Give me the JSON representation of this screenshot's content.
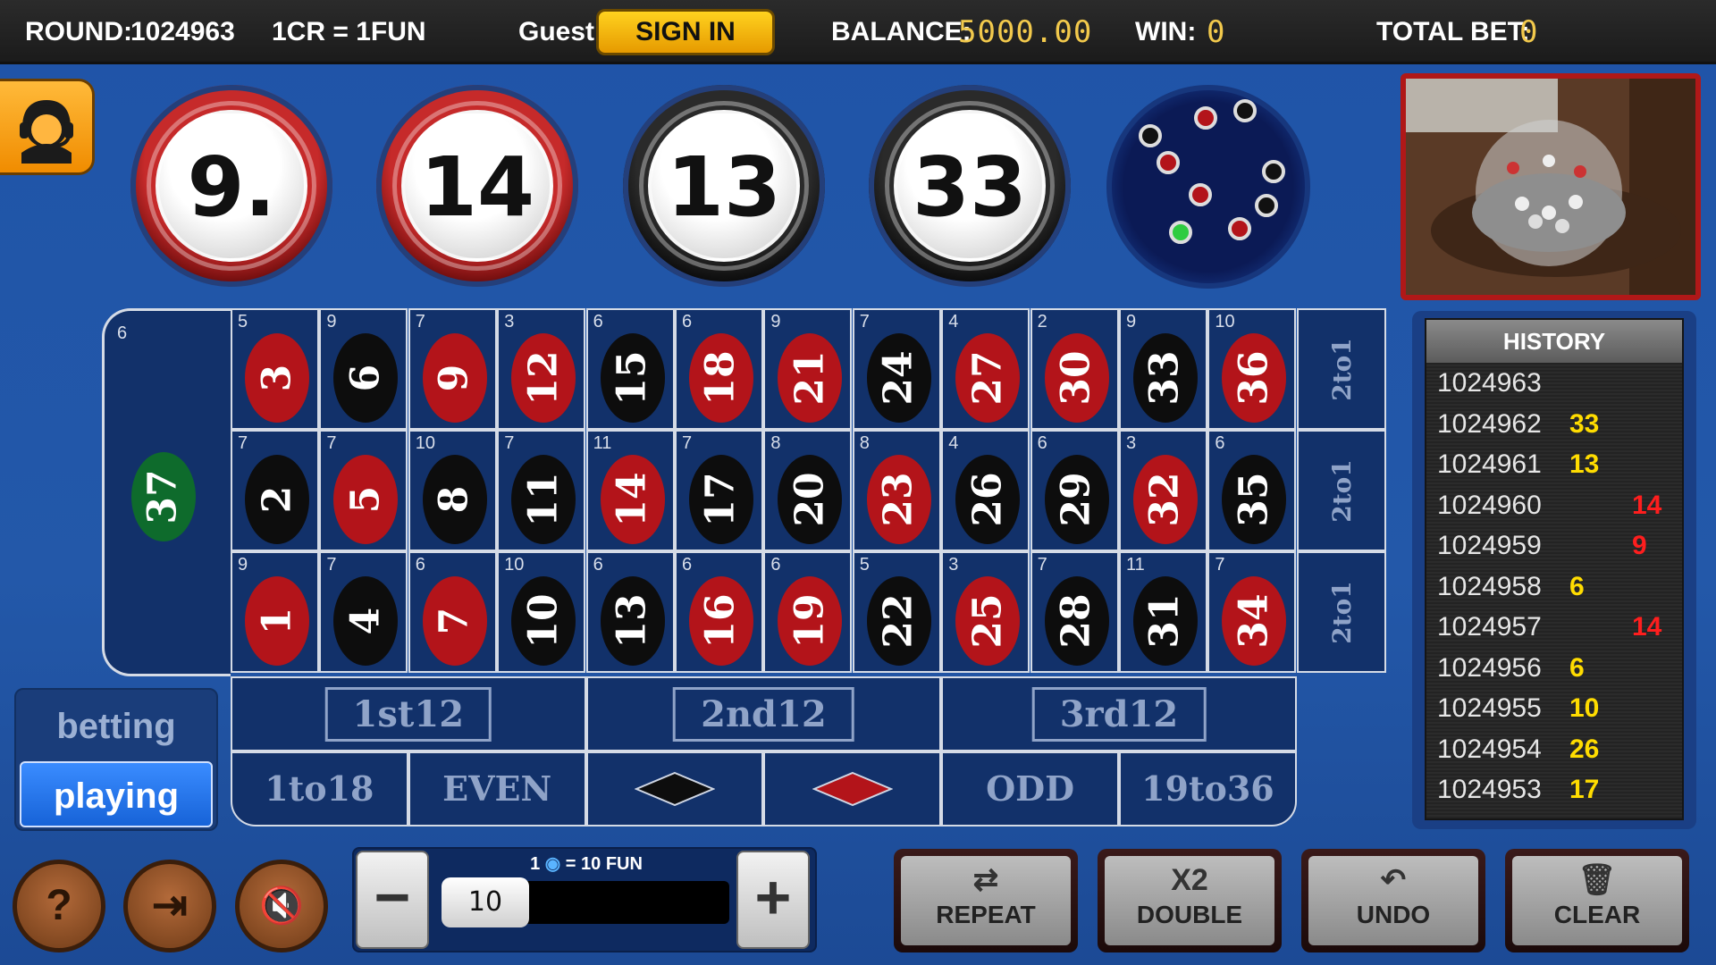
{
  "topbar": {
    "round_label": "ROUND:",
    "round_value": "1024963",
    "rate": "1CR = 1FUN",
    "user": "Guest",
    "signin_label": "SIGN IN",
    "balance_label": "BALANCE:",
    "balance_value": "5000.00",
    "win_label": "WIN:",
    "win_value": "0",
    "totalbet_label": "TOTAL BET:",
    "totalbet_value": "0"
  },
  "last_balls": [
    {
      "value": "9.",
      "color": "red"
    },
    {
      "value": "14",
      "color": "red"
    },
    {
      "value": "13",
      "color": "black"
    },
    {
      "value": "33",
      "color": "black"
    }
  ],
  "table": {
    "zero": {
      "number": "37",
      "chips": "6",
      "color": "green"
    },
    "rows": [
      [
        {
          "n": "3",
          "c": "red",
          "k": "5"
        },
        {
          "n": "6",
          "c": "black",
          "k": "9"
        },
        {
          "n": "9",
          "c": "red",
          "k": "7"
        },
        {
          "n": "12",
          "c": "red",
          "k": "3"
        },
        {
          "n": "15",
          "c": "black",
          "k": "6"
        },
        {
          "n": "18",
          "c": "red",
          "k": "6"
        },
        {
          "n": "21",
          "c": "red",
          "k": "9"
        },
        {
          "n": "24",
          "c": "black",
          "k": "7"
        },
        {
          "n": "27",
          "c": "red",
          "k": "4"
        },
        {
          "n": "30",
          "c": "red",
          "k": "2"
        },
        {
          "n": "33",
          "c": "black",
          "k": "9"
        },
        {
          "n": "36",
          "c": "red",
          "k": "10"
        }
      ],
      [
        {
          "n": "2",
          "c": "black",
          "k": "7"
        },
        {
          "n": "5",
          "c": "red",
          "k": "7"
        },
        {
          "n": "8",
          "c": "black",
          "k": "10"
        },
        {
          "n": "11",
          "c": "black",
          "k": "7"
        },
        {
          "n": "14",
          "c": "red",
          "k": "11"
        },
        {
          "n": "17",
          "c": "black",
          "k": "7"
        },
        {
          "n": "20",
          "c": "black",
          "k": "8"
        },
        {
          "n": "23",
          "c": "red",
          "k": "8"
        },
        {
          "n": "26",
          "c": "black",
          "k": "4"
        },
        {
          "n": "29",
          "c": "black",
          "k": "6"
        },
        {
          "n": "32",
          "c": "red",
          "k": "3"
        },
        {
          "n": "35",
          "c": "black",
          "k": "6"
        }
      ],
      [
        {
          "n": "1",
          "c": "red",
          "k": "9"
        },
        {
          "n": "4",
          "c": "black",
          "k": "7"
        },
        {
          "n": "7",
          "c": "red",
          "k": "6"
        },
        {
          "n": "10",
          "c": "black",
          "k": "10"
        },
        {
          "n": "13",
          "c": "black",
          "k": "6"
        },
        {
          "n": "16",
          "c": "red",
          "k": "6"
        },
        {
          "n": "19",
          "c": "red",
          "k": "6"
        },
        {
          "n": "22",
          "c": "black",
          "k": "5"
        },
        {
          "n": "25",
          "c": "red",
          "k": "3"
        },
        {
          "n": "28",
          "c": "black",
          "k": "7"
        },
        {
          "n": "31",
          "c": "black",
          "k": "11"
        },
        {
          "n": "34",
          "c": "red",
          "k": "7"
        }
      ]
    ],
    "column_bets": [
      "2to1",
      "2to1",
      "2to1"
    ],
    "dozens": [
      "1st12",
      "2nd12",
      "3rd12"
    ],
    "outside": [
      "1to18",
      "EVEN",
      "",
      "",
      "ODD",
      "19to36"
    ]
  },
  "history": {
    "title": "HISTORY",
    "rows": [
      {
        "round": "1024963",
        "value": "",
        "color": ""
      },
      {
        "round": "1024962",
        "value": "33",
        "color": "yellow"
      },
      {
        "round": "1024961",
        "value": "13",
        "color": "yellow"
      },
      {
        "round": "1024960",
        "value": "14",
        "color": "red"
      },
      {
        "round": "1024959",
        "value": "9",
        "color": "red"
      },
      {
        "round": "1024958",
        "value": "6",
        "color": "yellow"
      },
      {
        "round": "1024957",
        "value": "14",
        "color": "red"
      },
      {
        "round": "1024956",
        "value": "6",
        "color": "yellow"
      },
      {
        "round": "1024955",
        "value": "10",
        "color": "yellow"
      },
      {
        "round": "1024954",
        "value": "26",
        "color": "yellow"
      },
      {
        "round": "1024953",
        "value": "17",
        "color": "yellow"
      }
    ]
  },
  "mode": {
    "betting": "betting",
    "playing": "playing"
  },
  "round_buttons": [
    {
      "name": "help-button",
      "glyph": "?"
    },
    {
      "name": "exit-button",
      "glyph": "⇥"
    },
    {
      "name": "mute-button",
      "glyph": "🔇"
    }
  ],
  "stepper": {
    "caption_amount": "1",
    "caption_eq": "=",
    "caption_fun": "10 FUN",
    "value": "10",
    "minus": "−",
    "plus": "+"
  },
  "actions": [
    {
      "name": "repeat-button",
      "icon": "⇄",
      "label": "REPEAT"
    },
    {
      "name": "double-button",
      "icon": "X2",
      "label": "DOUBLE"
    },
    {
      "name": "undo-button",
      "icon": "↶",
      "label": "UNDO"
    },
    {
      "name": "clear-button",
      "icon": "🗑",
      "label": "CLEAR"
    }
  ],
  "colors": {
    "red": "#b3141a",
    "black": "#0d0d0d",
    "green": "#0e6b2c",
    "table_blue": "#12316a",
    "history_yellow": "#ffdc00",
    "history_red": "#ff1e1e",
    "digital_yellow": "#f2c94c"
  }
}
